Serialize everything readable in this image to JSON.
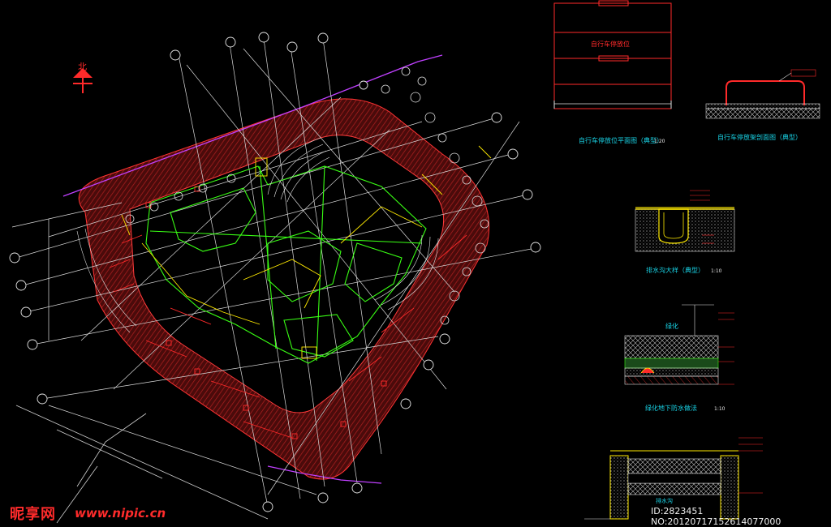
{
  "north_label": "北",
  "detail_a": {
    "title": "自行车停放位平面图（典型）",
    "scale": "1:20",
    "plan_title": "自行车停放位"
  },
  "detail_b": {
    "title": "自行车停放架剖面图（典型）"
  },
  "detail_c": {
    "title": "排水沟大样（典型）",
    "scale": "1:10"
  },
  "detail_d": {
    "label": "绿化",
    "title": "绿化地下防水做法",
    "scale": "1:10"
  },
  "detail_e": {
    "label": "排水沟"
  },
  "watermark": {
    "logo": "昵享网",
    "url": "www.nipic.cn",
    "id": "ID:2823451 NO:20120717152614077000"
  },
  "colors": {
    "background": "#000000",
    "paving_hatch": "#8b1a1a",
    "building_outline": "#39ff14",
    "grid_lines": "#e0e0e0",
    "site_boundary": "#c040ff",
    "annotation": "#ff2a2a",
    "label": "#19d3e6"
  }
}
